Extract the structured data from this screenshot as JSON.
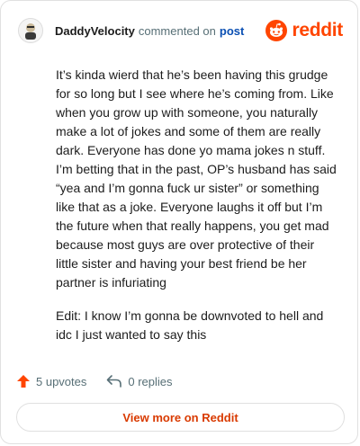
{
  "header": {
    "username": "DaddyVelocity",
    "commented_on": "commented on",
    "post_link": "post",
    "brand": "reddit"
  },
  "comment": {
    "paragraphs": [
      "It’s kinda wierd that he’s been having this grudge for so long but I see where he’s coming from. Like when you grow up with someone, you naturally make a lot of jokes and some of them are really dark. Everyone has done yo mama jokes n stuff. I’m betting that in the past, OP’s husband has said “yea and I’m gonna fuck ur sister” or something like that as a joke. Everyone laughs it off but I’m the future when that really happens, you get mad because most guys are over protective of their little sister and having your best friend be her partner is infuriating",
      "Edit: I know I’m gonna be downvoted to hell and idc I just wanted to say this"
    ]
  },
  "actions": {
    "upvotes": "5 upvotes",
    "replies": "0 replies"
  },
  "footer": {
    "view_more": "View more on Reddit"
  },
  "colors": {
    "brand": "#ff4500",
    "link": "#0a4fb3",
    "muted": "#576f76",
    "view_more": "#d93a00"
  },
  "icons": {
    "avatar": "avatar-icon",
    "brand": "reddit-snoo-icon",
    "upvote": "upvote-arrow-icon",
    "reply": "reply-arrow-icon"
  }
}
